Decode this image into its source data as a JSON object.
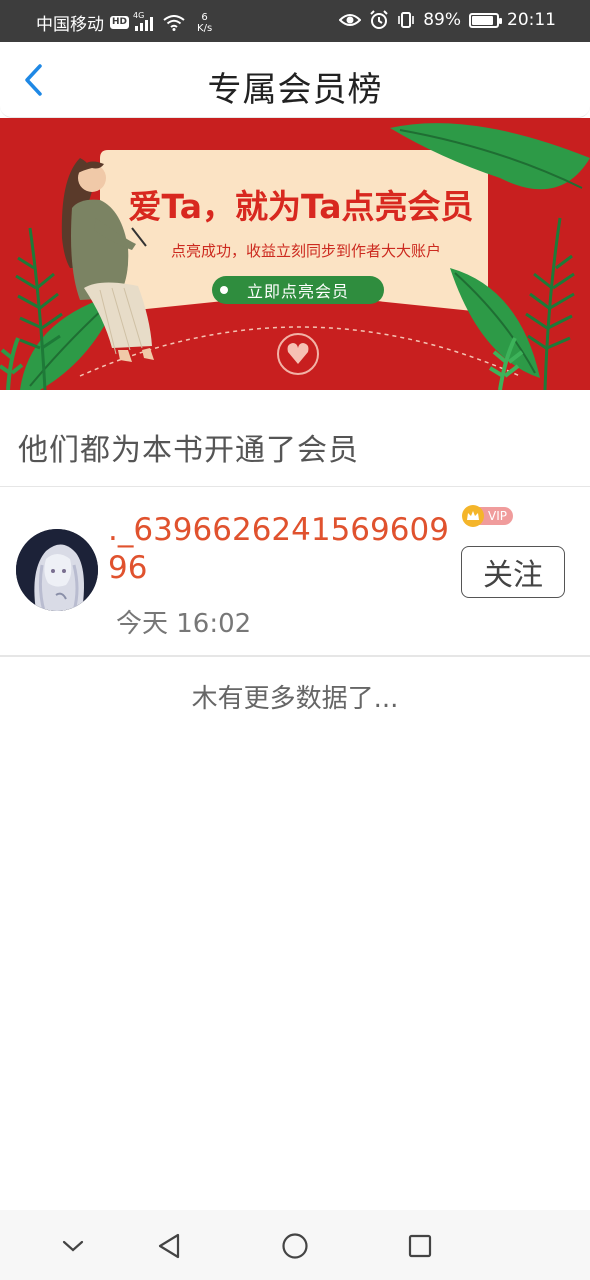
{
  "status_bar": {
    "carrier": "中国移动",
    "hd": "HD",
    "network": "4G",
    "speed_value": "6",
    "speed_unit": "K/s",
    "battery": "89%",
    "battery_level": 0.89,
    "time": "20:11"
  },
  "header": {
    "title": "专属会员榜"
  },
  "banner": {
    "headline": "爱Ta，就为Ta点亮会员",
    "subline": "点亮成功，收益立刻同步到作者大大账户",
    "cta": "立即点亮会员"
  },
  "section": {
    "title": "他们都为本书开通了会员"
  },
  "members": [
    {
      "name": "._639662624156960996",
      "badge": "VIP",
      "time": "今天 16:02",
      "follow_label": "关注"
    }
  ],
  "footer_text": "木有更多数据了...",
  "colors": {
    "accent_blue": "#1e88e5",
    "name_red": "#e0522e",
    "banner_red": "#c81f1f",
    "cta_green": "#2f8d3e"
  }
}
